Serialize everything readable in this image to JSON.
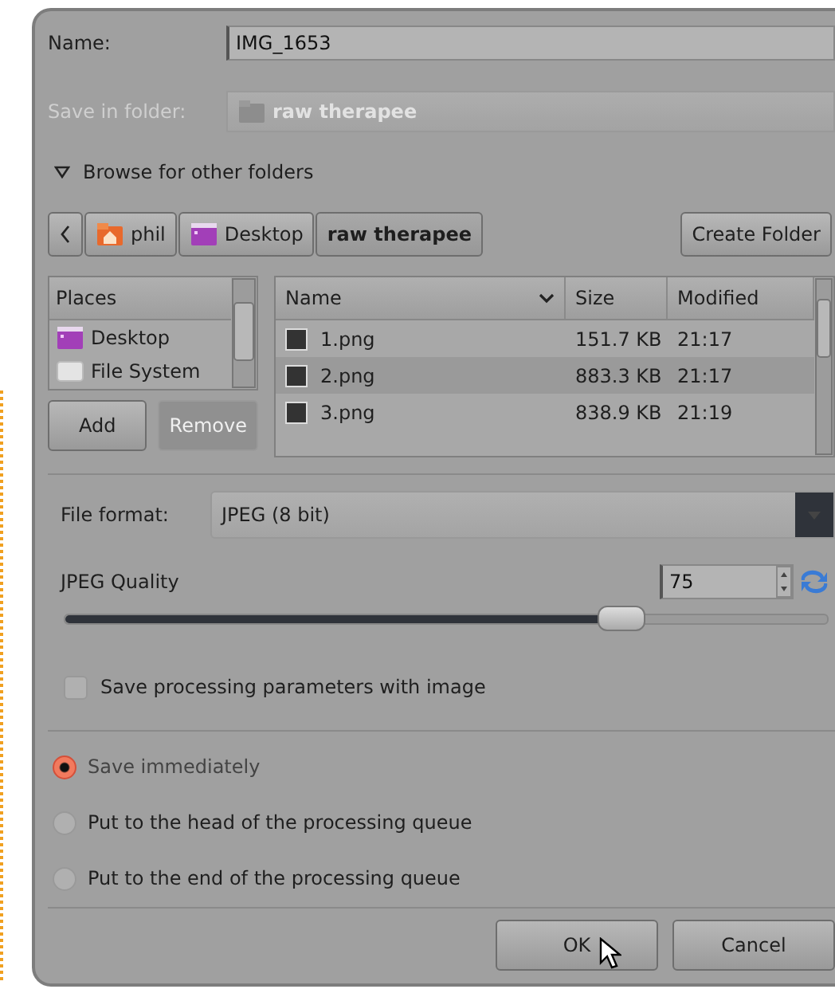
{
  "name_field": {
    "label": "Name:",
    "value": "IMG_1653"
  },
  "save_in_folder": {
    "label": "Save in folder:",
    "value": "raw therapee",
    "disabled": true
  },
  "browse_expander": {
    "label": "Browse for other folders",
    "expanded": true
  },
  "path_bar": [
    {
      "label": "phil",
      "kind": "home",
      "selected": false
    },
    {
      "label": "Desktop",
      "kind": "desktop",
      "selected": false
    },
    {
      "label": "raw therapee",
      "kind": "plain",
      "selected": true
    }
  ],
  "create_folder_button": "Create Folder",
  "places": {
    "header": "Places",
    "items": [
      {
        "label": "Desktop",
        "kind": "desktop"
      },
      {
        "label": "File System",
        "kind": "drive"
      }
    ],
    "buttons": [
      {
        "label": "Add",
        "disabled": false
      },
      {
        "label": "Remove",
        "disabled": true
      }
    ]
  },
  "files": {
    "columns": [
      "Name",
      "Size",
      "Modified"
    ],
    "rows": [
      {
        "name": "1.png",
        "size": "151.7 KB",
        "modified": "21:17"
      },
      {
        "name": "2.png",
        "size": "883.3 KB",
        "modified": "21:17"
      },
      {
        "name": "3.png",
        "size": "838.9 KB",
        "modified": "21:19"
      }
    ]
  },
  "file_format": {
    "label": "File format:",
    "value": "JPEG (8 bit)"
  },
  "jpeg_quality": {
    "label": "JPEG Quality",
    "value": "75",
    "level": 0.73
  },
  "save_params": {
    "label": "Save processing parameters with image",
    "checked": false
  },
  "save_options": [
    {
      "label": "Save immediately",
      "selected": true
    },
    {
      "label": "Put to the head of the processing queue",
      "selected": false
    },
    {
      "label": "Put to the end of the processing queue",
      "selected": false
    }
  ],
  "buttons": [
    "OK",
    "Cancel"
  ]
}
